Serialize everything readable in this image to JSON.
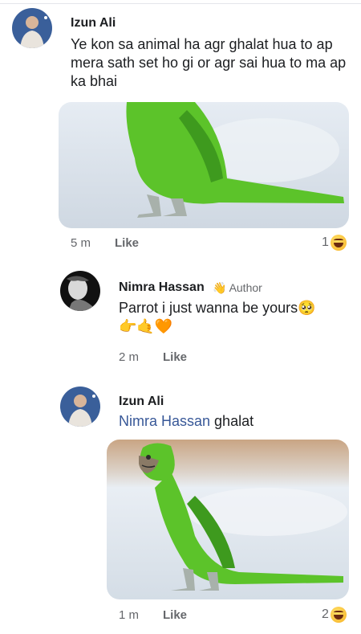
{
  "comments": [
    {
      "author": "Izun Ali",
      "text": "Ye kon sa animal ha agr ghalat hua to ap mera sath set ho gi or agr sai hua to ma ap ka bhai",
      "time": "5 m",
      "like_label": "Like",
      "reaction_count": "1",
      "reaction_icon": "haha-emoji-icon"
    },
    {
      "author": "Nimra Hassan",
      "badge_icon": "waving-hand-icon",
      "badge": "Author",
      "text": "Parrot i just wanna be yours",
      "emoji_text": "👉🤙🧡",
      "time": "2 m",
      "like_label": "Like"
    },
    {
      "author": "Izun Ali",
      "mention": "Nimra Hassan",
      "text": "ghalat",
      "time": "1 m",
      "like_label": "Like",
      "reaction_count": "2",
      "reaction_icon": "haha-emoji-icon"
    }
  ],
  "colors": {
    "mention": "#385898",
    "meta": "#65676b",
    "parrot_green": "#5cc32a"
  }
}
